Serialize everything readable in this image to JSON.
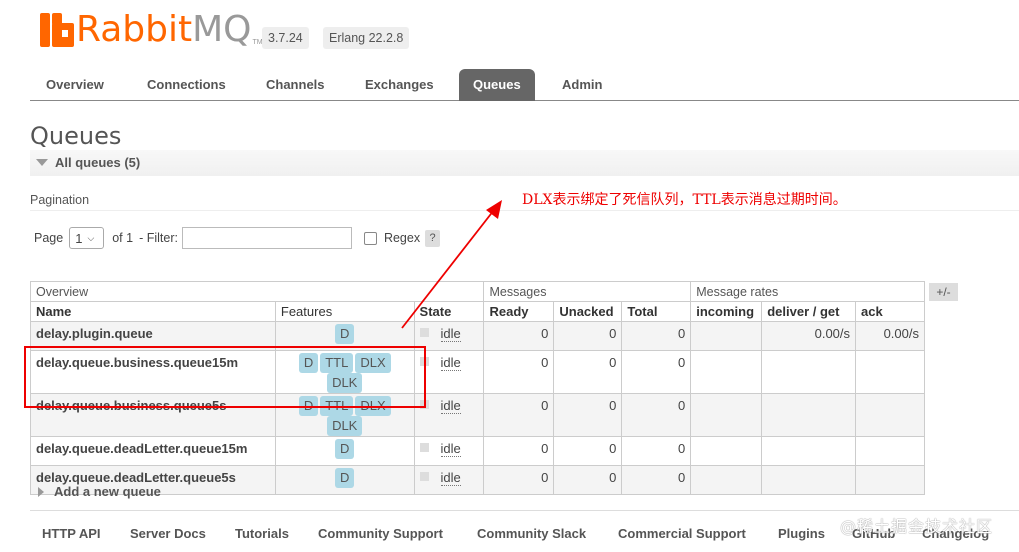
{
  "header": {
    "logo_rabbit": "Rabbit",
    "logo_mq": "MQ",
    "logo_tm": "TM",
    "version": "3.7.24",
    "erlang": "Erlang 22.2.8"
  },
  "tabs": [
    "Overview",
    "Connections",
    "Channels",
    "Exchanges",
    "Queues",
    "Admin"
  ],
  "active_tab": "Queues",
  "page_title": "Queues",
  "section": {
    "label": "All queues (5)"
  },
  "pagination": {
    "label": "Pagination",
    "page_label": "Page",
    "page_value": "1",
    "of_label": "of 1",
    "filter_label": "- Filter:",
    "filter_value": "",
    "regex_label": "Regex",
    "help": "?"
  },
  "table": {
    "group_headers": [
      "Overview",
      "Messages",
      "Message rates"
    ],
    "plus_minus": "+/-",
    "columns": [
      "Name",
      "Features",
      "State",
      "Ready",
      "Unacked",
      "Total",
      "incoming",
      "deliver / get",
      "ack"
    ],
    "rows": [
      {
        "name": "delay.plugin.queue",
        "features": [
          "D"
        ],
        "state": "idle",
        "ready": "0",
        "unacked": "0",
        "total": "0",
        "incoming": "",
        "deliver": "0.00/s",
        "ack": "0.00/s"
      },
      {
        "name": "delay.queue.business.queue15m",
        "features": [
          "D",
          "TTL",
          "DLX",
          "DLK"
        ],
        "state": "idle",
        "ready": "0",
        "unacked": "0",
        "total": "0",
        "incoming": "",
        "deliver": "",
        "ack": ""
      },
      {
        "name": "delay.queue.business.queue5s",
        "features": [
          "D",
          "TTL",
          "DLX",
          "DLK"
        ],
        "state": "idle",
        "ready": "0",
        "unacked": "0",
        "total": "0",
        "incoming": "",
        "deliver": "",
        "ack": ""
      },
      {
        "name": "delay.queue.deadLetter.queue15m",
        "features": [
          "D"
        ],
        "state": "idle",
        "ready": "0",
        "unacked": "0",
        "total": "0",
        "incoming": "",
        "deliver": "",
        "ack": ""
      },
      {
        "name": "delay.queue.deadLetter.queue5s",
        "features": [
          "D"
        ],
        "state": "idle",
        "ready": "0",
        "unacked": "0",
        "total": "0",
        "incoming": "",
        "deliver": "",
        "ack": ""
      }
    ]
  },
  "annotation": "DLX表示绑定了死信队列，TTL表示消息过期时间。",
  "add_queue": "Add a new queue",
  "footer": [
    "HTTP API",
    "Server Docs",
    "Tutorials",
    "Community Support",
    "Community Slack",
    "Commercial Support",
    "Plugins",
    "GitHub",
    "Changelog"
  ],
  "watermark": "@稀土掘金技术社区",
  "colors": {
    "brand": "#ff6600",
    "badge": "#add8e6",
    "annotation": "#ee0000"
  }
}
